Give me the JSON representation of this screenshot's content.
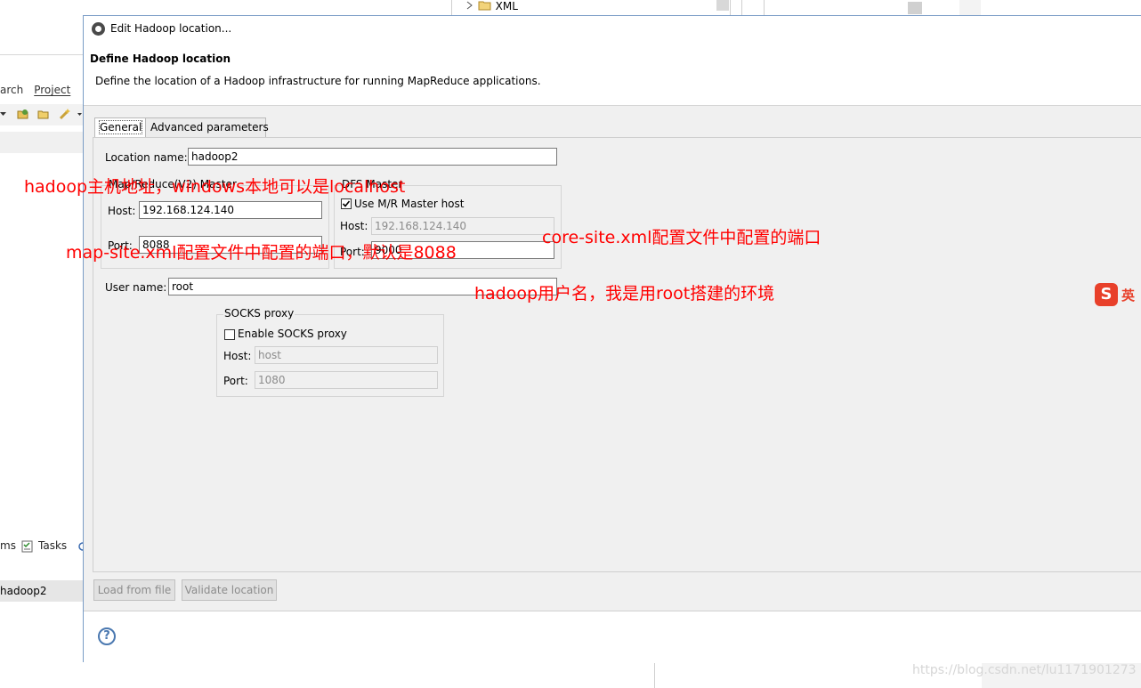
{
  "background": {
    "menu_items": [
      "arch",
      "Project"
    ],
    "tree_item_xml": "XML",
    "bottom_tabs": [
      "ms",
      "Tasks"
    ],
    "tree_item_hadoop": "hadoop2"
  },
  "dialog": {
    "title": "Edit Hadoop location...",
    "header_title": "Define Hadoop location",
    "header_desc": "Define the location of a Hadoop infrastructure for running MapReduce applications.",
    "tabs": [
      {
        "label": "General",
        "active": true
      },
      {
        "label": "Advanced parameters",
        "active": false
      }
    ],
    "location_name": {
      "label": "Location name:",
      "value": "hadoop2"
    },
    "mr_master": {
      "title": "Map/Reduce(V2) Master",
      "host_label": "Host:",
      "host_value": "192.168.124.140",
      "port_label": "Port:",
      "port_value": "8088"
    },
    "dfs_master": {
      "title": "DFS Master",
      "use_mr_label": "Use M/R Master host",
      "use_mr_checked": true,
      "host_label": "Host:",
      "host_value": "192.168.124.140",
      "port_label": "Port:",
      "port_value": "9000"
    },
    "user_name": {
      "label": "User name:",
      "value": "root"
    },
    "socks": {
      "title": "SOCKS proxy",
      "enable_label": "Enable SOCKS proxy",
      "enable_checked": false,
      "host_label": "Host:",
      "host_placeholder": "host",
      "port_label": "Port:",
      "port_placeholder": "1080"
    },
    "buttons": {
      "load": "Load from file",
      "validate": "Validate location"
    },
    "help_glyph": "?"
  },
  "annotations": {
    "host_note": "hadoop主机地址，windows本地可以是localhost",
    "mr_port_note": "map-site.xml配置文件中配置的端口，默认是8088",
    "dfs_port_note": "core-site.xml配置文件中配置的端口",
    "user_note": "hadoop用户名，我是用root搭建的环境"
  },
  "ime": {
    "label": "英",
    "logo": "S"
  },
  "watermark": "https://blog.csdn.net/lu1171901273",
  "colors": {
    "annotation": "#ff0000",
    "dialog_border": "#7a9cc6",
    "help": "#4a78b0"
  }
}
